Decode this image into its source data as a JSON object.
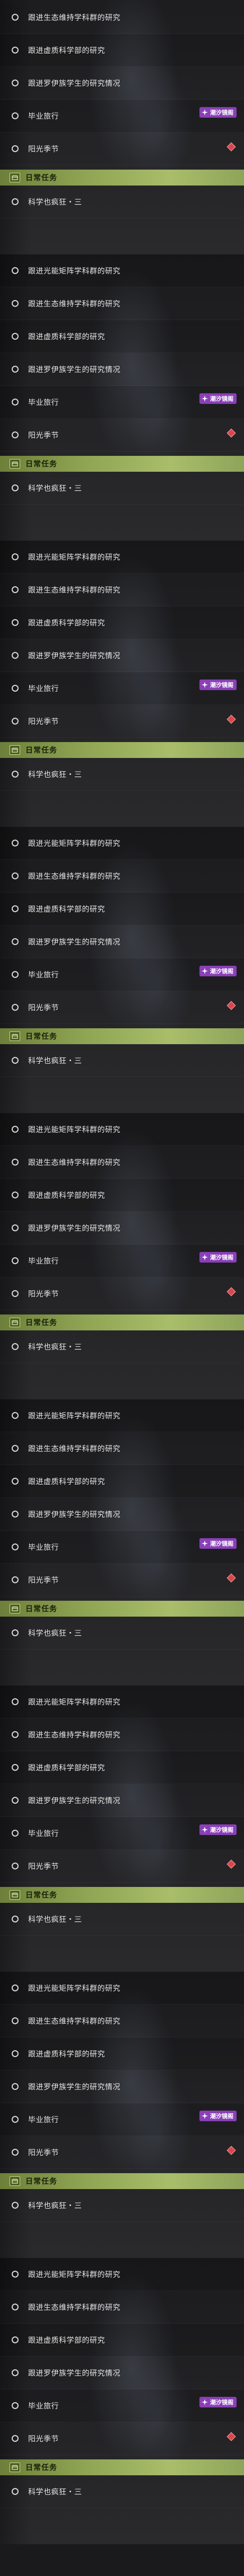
{
  "weekly_tasks": [
    {
      "label": "跟进光能矩阵学科群的研究"
    },
    {
      "label": "跟进生态维持学科群的研究"
    },
    {
      "label": "跟进虚质科学部的研究"
    },
    {
      "label": "跟进罗伊族学生的研究情况"
    },
    {
      "label": "毕业旅行"
    },
    {
      "label": "阳光季节"
    }
  ],
  "badge_text": "潮汐镜阁",
  "daily_header": "日常任务",
  "daily_tasks": [
    {
      "label": "科学也疯狂・三"
    }
  ],
  "colors": {
    "badge": "#8a3fb8",
    "header_green": "#8fa553",
    "marker_red": "#d9474d"
  }
}
